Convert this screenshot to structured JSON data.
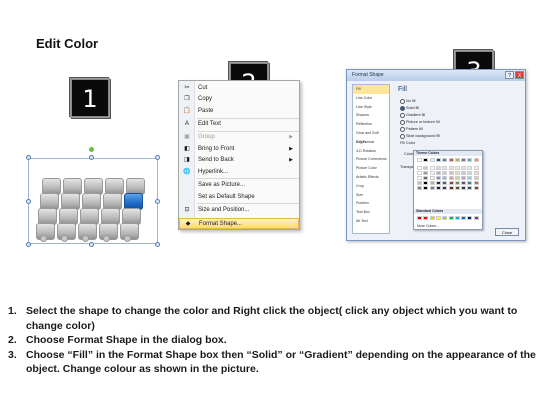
{
  "title": "Edit Color",
  "badges": [
    "1",
    "2",
    "3"
  ],
  "context_menu": {
    "items": [
      {
        "label": "Cut",
        "icon": "scissors-icon",
        "glyph": "✂",
        "disabled": false,
        "submenu": false
      },
      {
        "label": "Copy",
        "icon": "copy-icon",
        "glyph": "❐",
        "disabled": false,
        "submenu": false
      },
      {
        "label": "Paste",
        "icon": "paste-icon",
        "glyph": "📋",
        "disabled": false,
        "submenu": false
      },
      {
        "label": "Edit Text",
        "icon": "edit-text-icon",
        "glyph": "A",
        "disabled": false,
        "submenu": false
      },
      {
        "label": "Group",
        "icon": "group-icon",
        "glyph": "▣",
        "disabled": true,
        "submenu": true
      },
      {
        "label": "Bring to Front",
        "icon": "bring-front-icon",
        "glyph": "◧",
        "disabled": false,
        "submenu": true
      },
      {
        "label": "Send to Back",
        "icon": "send-back-icon",
        "glyph": "◨",
        "disabled": false,
        "submenu": true
      },
      {
        "label": "Hyperlink...",
        "icon": "hyperlink-icon",
        "glyph": "🌐",
        "disabled": false,
        "submenu": false
      },
      {
        "label": "Save as Picture...",
        "icon": "",
        "glyph": "",
        "disabled": false,
        "submenu": false
      },
      {
        "label": "Set as Default Shape",
        "icon": "",
        "glyph": "",
        "disabled": false,
        "submenu": false
      },
      {
        "label": "Size and Position...",
        "icon": "size-position-icon",
        "glyph": "⊡",
        "disabled": false,
        "submenu": false
      },
      {
        "label": "Format Shape...",
        "icon": "format-shape-icon",
        "glyph": "◆",
        "disabled": false,
        "submenu": false
      }
    ]
  },
  "dialog": {
    "title": "Format Shape",
    "help": "?",
    "close": "X",
    "left_items": [
      "Fill",
      "Line Color",
      "Line Style",
      "Shadow",
      "Reflection",
      "Glow and Soft Edges",
      "3-D Format",
      "3-D Rotation",
      "Picture Corrections",
      "Picture Color",
      "Artistic Effects",
      "Crop",
      "Size",
      "Position",
      "Text Box",
      "Alt Text"
    ],
    "fill_heading": "Fill",
    "fill_options": [
      "No fill",
      "Solid fill",
      "Gradient fill",
      "Picture or texture fill",
      "Pattern fill",
      "Slide background fill"
    ],
    "selected_fill": 1,
    "fill_color_label": "Fill Color",
    "color_label": "Color:",
    "transparency_label": "Transparency:",
    "theme_colors_label": "Theme Colors",
    "standard_colors_label": "Standard Colors",
    "more_colors": "More Colors...",
    "close_button": "Close",
    "theme_top": [
      "#ffffff",
      "#000000",
      "#eeece1",
      "#1f497d",
      "#4f81bd",
      "#c0504d",
      "#9bbb59",
      "#8064a2",
      "#4bacc6",
      "#f79646"
    ],
    "standard": [
      "#c00000",
      "#ff0000",
      "#ffc000",
      "#ffff00",
      "#92d050",
      "#00b050",
      "#00b0f0",
      "#0070c0",
      "#002060",
      "#7030a0"
    ]
  },
  "steps": [
    {
      "num": "1.",
      "text": "Select the shape to change the color and Right click the object( click any object which you want to change color)"
    },
    {
      "num": "2.",
      "text": "Choose Format Shape in the dialog box."
    },
    {
      "num": "3.",
      "text": "Choose “Fill” in the Format Shape box then “Solid” or “Gradient” depending on the appearance of the object. Change colour as shown in the picture."
    }
  ]
}
